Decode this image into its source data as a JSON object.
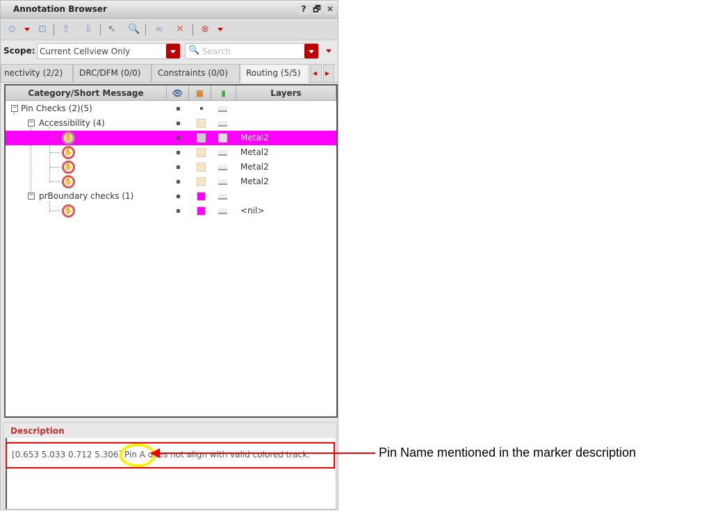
{
  "window": {
    "title": "Annotation Browser",
    "help": "?",
    "restore": "🗗",
    "close": "✕"
  },
  "toolbar": {
    "icons": [
      "zoom-fit-icon",
      "zoom-selected-icon",
      "previous-icon",
      "next-icon",
      "select-icon",
      "zoom-icon",
      "link-icon",
      "unlink-icon",
      "stop-icon"
    ]
  },
  "scope": {
    "label": "Scope:",
    "value": "Current Cellview Only",
    "search_placeholder": "Search"
  },
  "tabs": [
    {
      "label": "nectivity (2/2)"
    },
    {
      "label": "DRC/DFM (0/0)"
    },
    {
      "label": "Constraints (0/0)"
    },
    {
      "label": "Routing (5/5)",
      "active": true
    }
  ],
  "tree": {
    "headers": {
      "category": "Category/Short Message",
      "layers": "Layers"
    },
    "rows": [
      {
        "label": "Pin Checks (2)(5)",
        "layer": ""
      },
      {
        "label": "Accessibility (4)",
        "layer": ""
      },
      {
        "label": "",
        "layer": "Metal2",
        "selected": true
      },
      {
        "label": "",
        "layer": "Metal2"
      },
      {
        "label": "",
        "layer": "Metal2"
      },
      {
        "label": "",
        "layer": "Metal2"
      },
      {
        "label": "prBoundary checks (1)",
        "layer": ""
      },
      {
        "label": "",
        "layer": "<nil>"
      }
    ]
  },
  "description": {
    "label": "Description",
    "text": "[0.653 5.033 0.712 5.306] Pin A does not align with valid colored track."
  },
  "annotation": {
    "callout": "Pin Name mentioned in the marker description",
    "colors": {
      "box": "#e00000",
      "highlight": "#ffef00"
    }
  }
}
